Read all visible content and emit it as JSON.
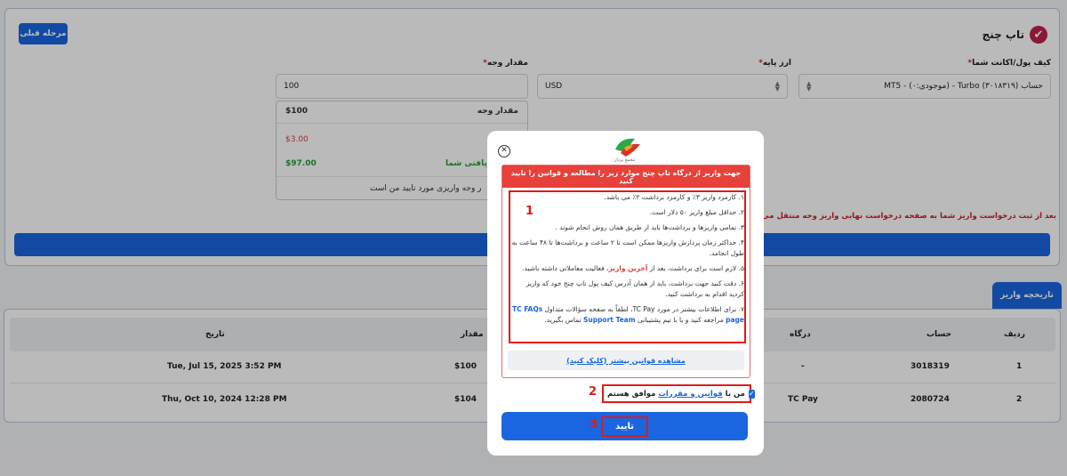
{
  "header": {
    "title": "تاپ چنج",
    "prev_button": "مرحله قبلی"
  },
  "form": {
    "wallet_label": "کیف پول/اکانت شما",
    "wallet_value": "حساب Turbo (۳۰۱۸۳۱۹) - (موجودی:۰) - MT5",
    "currency_label": "ارز پایه",
    "currency_value": "USD",
    "amount_label": "مقدار وجه",
    "amount_value": "100",
    "required_mark": "*"
  },
  "summary": {
    "amount_label": "مقدار وجه",
    "amount_value": "$100",
    "fee_value": "$3.00",
    "received_label": "ه دریافتی شما",
    "received_value": "$97.00",
    "confirm_text": "ر وجه واریزی مورد تایید من است"
  },
  "notice_text": "بعد از ثبت درخواست واریز شما به صفحه درخواست نهایی واریز وجه منتقل می شو",
  "main_button": "ع",
  "history": {
    "tab": "تاریخچه واریز",
    "columns": [
      "ردیف",
      "حساب",
      "درگاه",
      "مقدار",
      "تاریخ"
    ],
    "rows": [
      {
        "index": "1",
        "account": "3018319",
        "gateway": "-",
        "amount": "$100",
        "date": "Tue, Jul 15, 2025 3:52 PM"
      },
      {
        "index": "2",
        "account": "2080724",
        "gateway": "TC Pay",
        "amount": "$104",
        "date": "Thu, Oct 10, 2024 12:28 PM"
      }
    ]
  },
  "modal": {
    "logo_text": "مجمع پرداز",
    "heading": "جهت واریز از درگاه تاپ چنج موارد زیر را مطالعه و قوانین را تایید کنید",
    "rules": [
      "۱. کارمزد واریز ۳٪ و کارمزد برداشت ۲٪ می باشد.",
      "۲. حداقل مبلغ واریز ۵۰ دلار است.",
      "۳. تمامی واریزها و برداشت‌ها باید از طریق همان روش انجام شوند .",
      "۴. حداکثر زمان پردازش واریزها ممکن است تا ۲ ساعت و برداشت‌ها تا ۴۸ ساعت به طول انجامد.",
      "۵. لازم است برای برداشت، بعد از",
      "آخرین واریز",
      "، فعالیت معاملاتی داشته باشید.",
      "۶. دقت کنید جهت برداشت، باید از همان آدرس کیف پول تاپ چنج خود که واریز کردید اقدام به برداشت کنید.",
      "۷. برای اطلاعات بیشتر در مورد TC Pay، لطفاً به صفحه سؤالات متداول",
      "TC FAQs page",
      "مراجعه کنید و یا با تیم پشتیبانی",
      "Support Team",
      "تماس بگیرید."
    ],
    "more_link": "مشاهده قوانین بیشتر (کلیک کنید)",
    "agree_prefix": "من با",
    "agree_link": "قوانین و مقررات",
    "agree_suffix": "موافق هستم",
    "confirm_button": "تایید",
    "marker_1": "1",
    "marker_2": "2",
    "marker_3": "3"
  },
  "colors": {
    "accent": "#1a66e0",
    "danger": "#e03a3a",
    "success": "#2a9a3a",
    "annotation": "#e01a1a"
  }
}
